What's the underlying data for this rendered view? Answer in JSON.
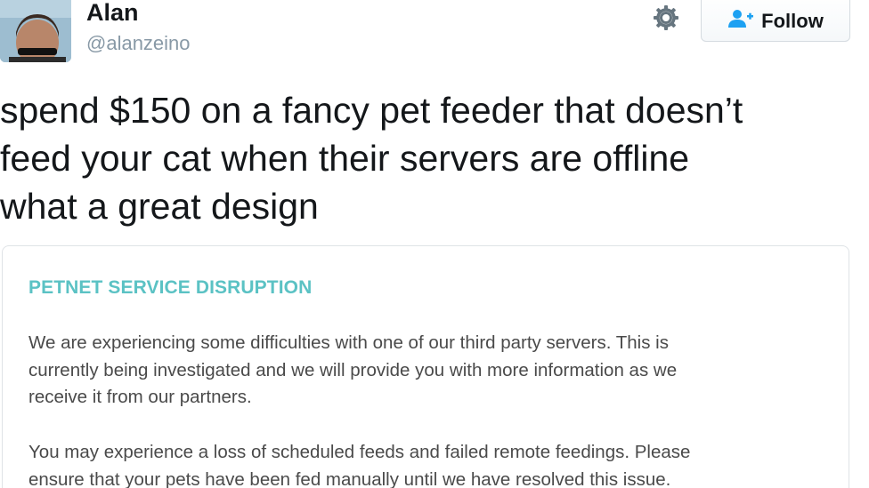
{
  "user": {
    "display_name": "Alan",
    "handle": "@alanzeino",
    "avatar_icon": "user-photo-avatar"
  },
  "actions": {
    "gear_icon": "gear-icon",
    "follow_icon": "add-user-icon",
    "follow_label": "Follow"
  },
  "tweet": {
    "lines": [
      "spend $150 on a fancy pet feeder that doesn’t",
      "feed your cat when their servers are offline",
      "what a great design"
    ]
  },
  "card": {
    "title": "PETNET SERVICE DISRUPTION",
    "paragraph_1": [
      "We are experiencing some difficulties with one of our third party servers. This is",
      "currently being investigated and we will provide you with more information as we",
      "receive it from our partners."
    ],
    "paragraph_2": [
      "You may experience a loss of scheduled feeds and failed remote feedings. Please",
      "ensure that your pets have been fed manually until we have resolved this issue."
    ]
  },
  "colors": {
    "card_title": "#5bc2c4",
    "follow_icon": "#1da1f2",
    "handle": "#8899a6",
    "gear": "#66757f"
  }
}
